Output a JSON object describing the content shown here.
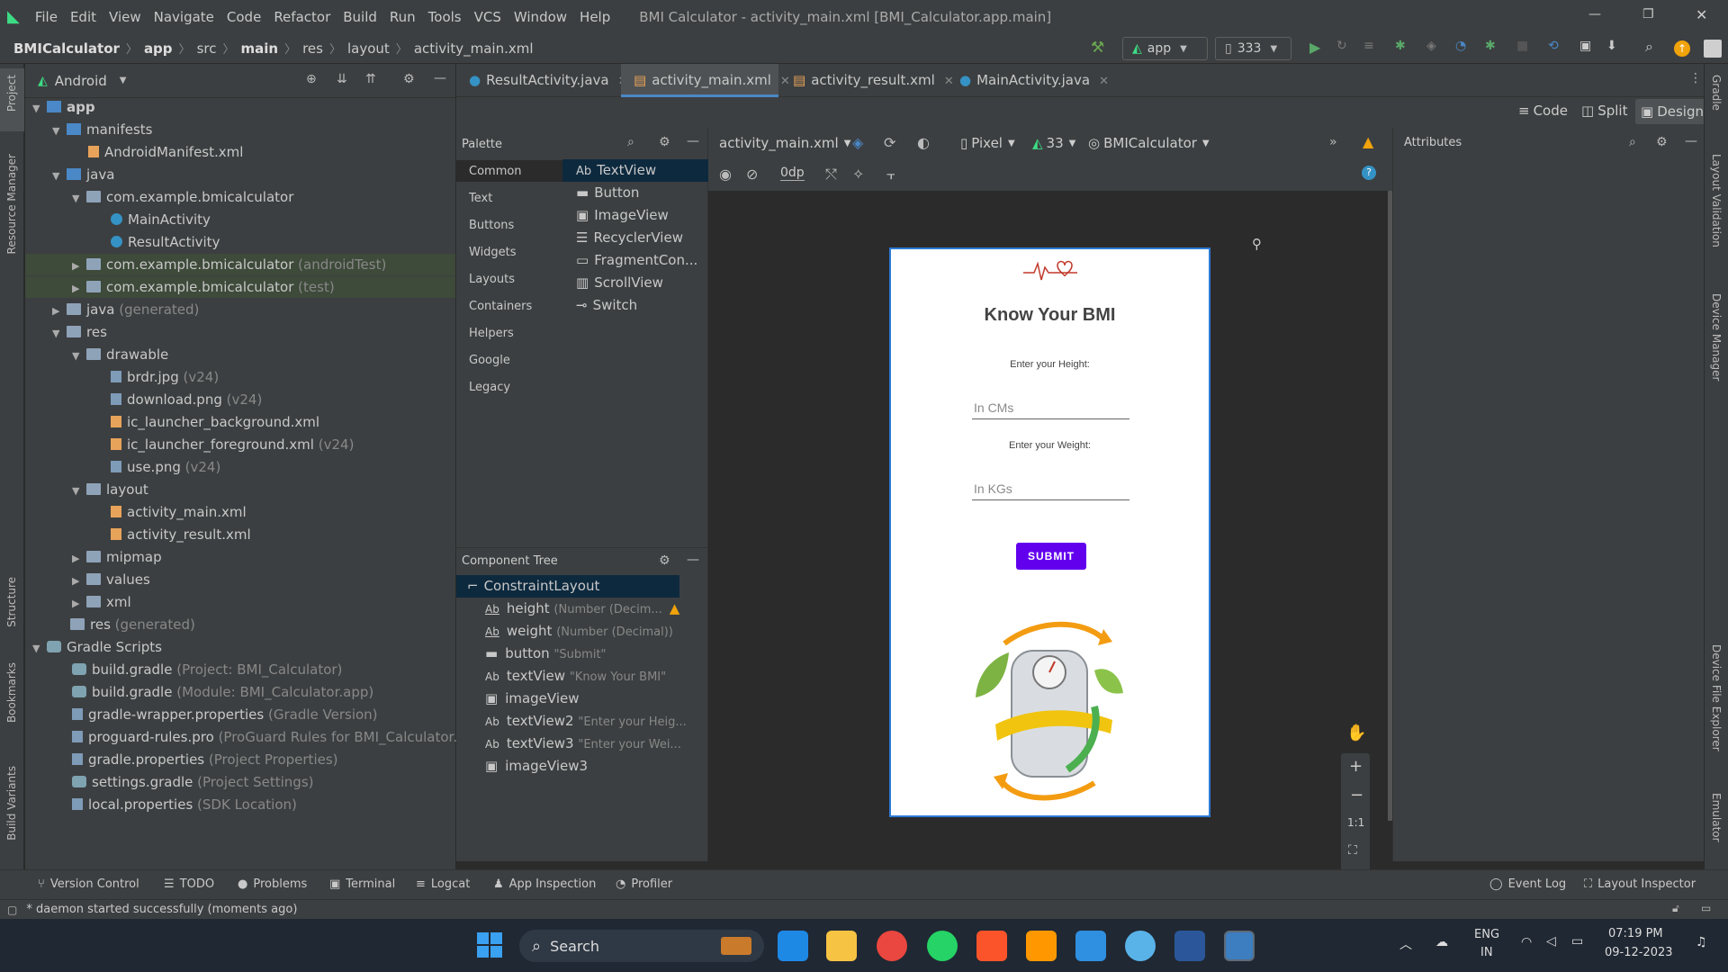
{
  "window": {
    "title": "BMI Calculator - activity_main.xml [BMI_Calculator.app.main]",
    "menu": [
      "File",
      "Edit",
      "View",
      "Navigate",
      "Code",
      "Refactor",
      "Build",
      "Run",
      "Tools",
      "VCS",
      "Window",
      "Help"
    ]
  },
  "breadcrumb": [
    "BMICalculator",
    "app",
    "src",
    "main",
    "res",
    "layout",
    "activity_main.xml"
  ],
  "toolbar": {
    "run_config": "app",
    "device": "333"
  },
  "project_panel": {
    "view_label": "Android",
    "tree": [
      {
        "label": "app",
        "hint": ""
      },
      {
        "label": "manifests",
        "hint": ""
      },
      {
        "label": "AndroidManifest.xml",
        "hint": ""
      },
      {
        "label": "java",
        "hint": ""
      },
      {
        "label": "com.example.bmicalculator",
        "hint": ""
      },
      {
        "label": "MainActivity",
        "hint": ""
      },
      {
        "label": "ResultActivity",
        "hint": ""
      },
      {
        "label": "com.example.bmicalculator",
        "hint": "(androidTest)"
      },
      {
        "label": "com.example.bmicalculator",
        "hint": "(test)"
      },
      {
        "label": "java",
        "hint": "(generated)"
      },
      {
        "label": "res",
        "hint": ""
      },
      {
        "label": "drawable",
        "hint": ""
      },
      {
        "label": "brdr.jpg",
        "hint": "(v24)"
      },
      {
        "label": "download.png",
        "hint": "(v24)"
      },
      {
        "label": "ic_launcher_background.xml",
        "hint": ""
      },
      {
        "label": "ic_launcher_foreground.xml",
        "hint": "(v24)"
      },
      {
        "label": "use.png",
        "hint": "(v24)"
      },
      {
        "label": "layout",
        "hint": ""
      },
      {
        "label": "activity_main.xml",
        "hint": ""
      },
      {
        "label": "activity_result.xml",
        "hint": ""
      },
      {
        "label": "mipmap",
        "hint": ""
      },
      {
        "label": "values",
        "hint": ""
      },
      {
        "label": "xml",
        "hint": ""
      },
      {
        "label": "res",
        "hint": "(generated)"
      },
      {
        "label": "Gradle Scripts",
        "hint": ""
      },
      {
        "label": "build.gradle",
        "hint": "(Project: BMI_Calculator)"
      },
      {
        "label": "build.gradle",
        "hint": "(Module: BMI_Calculator.app)"
      },
      {
        "label": "gradle-wrapper.properties",
        "hint": "(Gradle Version)"
      },
      {
        "label": "proguard-rules.pro",
        "hint": "(ProGuard Rules for BMI_Calculator.app)"
      },
      {
        "label": "gradle.properties",
        "hint": "(Project Properties)"
      },
      {
        "label": "settings.gradle",
        "hint": "(Project Settings)"
      },
      {
        "label": "local.properties",
        "hint": "(SDK Location)"
      }
    ]
  },
  "editor_tabs": [
    "ResultActivity.java",
    "activity_main.xml",
    "activity_result.xml",
    "MainActivity.java"
  ],
  "view_modes": [
    "Code",
    "Split",
    "Design"
  ],
  "palette": {
    "title": "Palette",
    "categories": [
      "Common",
      "Text",
      "Buttons",
      "Widgets",
      "Layouts",
      "Containers",
      "Helpers",
      "Google",
      "Legacy"
    ],
    "items": [
      "TextView",
      "Button",
      "ImageView",
      "RecyclerView",
      "FragmentCon...",
      "ScrollView",
      "Switch"
    ]
  },
  "component_tree": {
    "title": "Component Tree",
    "rows": [
      {
        "name": "ConstraintLayout",
        "hint": ""
      },
      {
        "name": "height",
        "hint": "(Number (Decim..."
      },
      {
        "name": "weight",
        "hint": "(Number (Decimal))"
      },
      {
        "name": "button",
        "hint": "\"Submit\""
      },
      {
        "name": "textView",
        "hint": "\"Know Your BMI\""
      },
      {
        "name": "imageView",
        "hint": ""
      },
      {
        "name": "textView2",
        "hint": "\"Enter your Heig..."
      },
      {
        "name": "textView3",
        "hint": "\"Enter your Wei..."
      },
      {
        "name": "imageView3",
        "hint": ""
      }
    ]
  },
  "design_toolbar": {
    "file": "activity_main.xml",
    "device": "Pixel",
    "api": "33",
    "theme": "BMICalculator",
    "margin": "0dp"
  },
  "attributes_title": "Attributes",
  "preview": {
    "title": "Know Your BMI",
    "height_label": "Enter your Height:",
    "height_placeholder": "In CMs",
    "weight_label": "Enter your Weight:",
    "weight_placeholder": "In KGs",
    "submit": "SUBMIT"
  },
  "zoom_controls": {
    "fit": "1:1"
  },
  "left_tool_windows": [
    "Project",
    "Resource Manager",
    "Structure",
    "Bookmarks",
    "Build Variants"
  ],
  "right_tool_windows": [
    "Gradle",
    "Layout Validation",
    "Device Manager",
    "Device File Explorer",
    "Emulator"
  ],
  "bottom_tabs": [
    "Version Control",
    "TODO",
    "Problems",
    "Terminal",
    "Logcat",
    "App Inspection",
    "Profiler"
  ],
  "bottom_right_tabs": [
    "Event Log",
    "Layout Inspector"
  ],
  "status": "* daemon started successfully (moments ago)",
  "taskbar": {
    "search_placeholder": "Search",
    "language": "ENG",
    "region": "IN",
    "time": "07:19 PM",
    "date": "09-12-2023"
  },
  "colors": {
    "accent": "#4a88c7",
    "button_purple": "#6200ee",
    "ide_bg": "#2b2b2b",
    "panel": "#3c3f41"
  }
}
